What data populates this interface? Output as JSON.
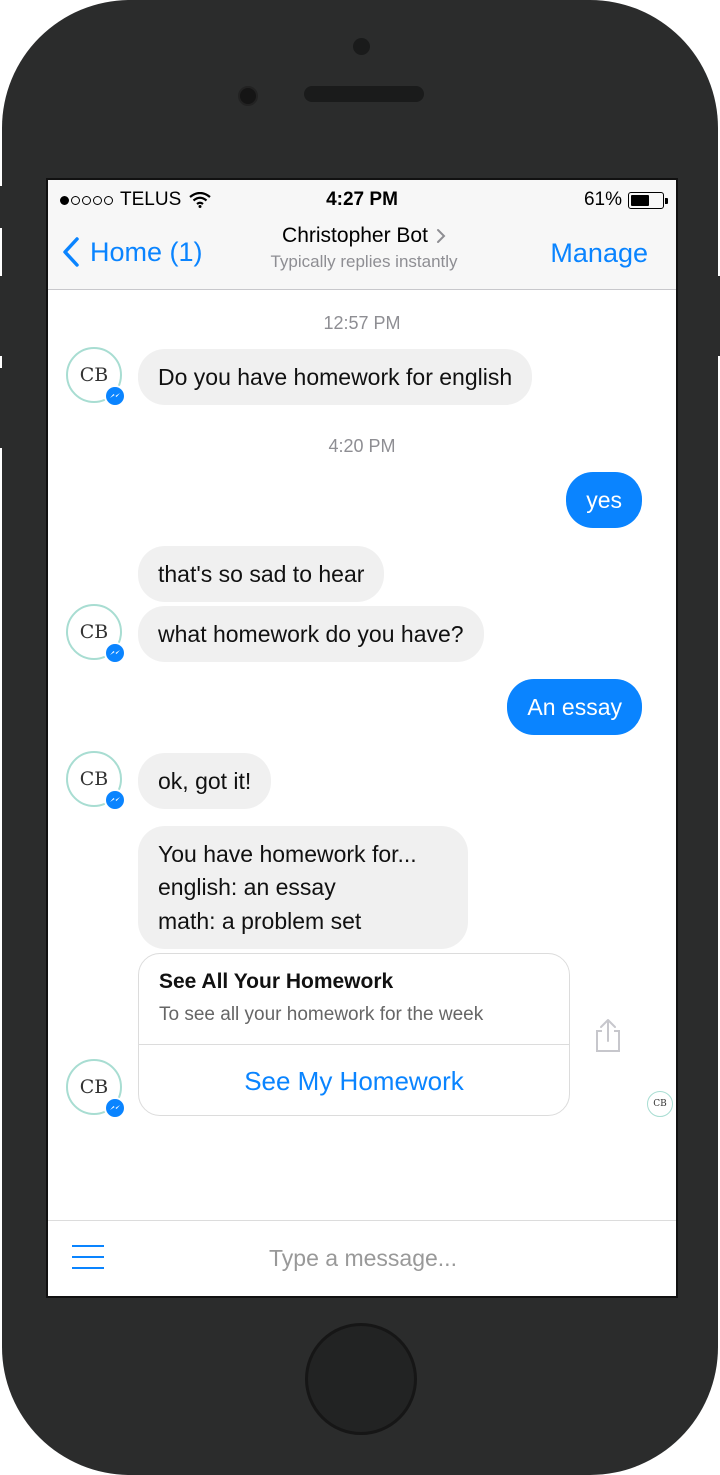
{
  "status_bar": {
    "carrier": "TELUS",
    "time": "4:27 PM",
    "battery_percent": "61%",
    "battery_level": 0.61,
    "signal_bars_filled": 1,
    "signal_bars_total": 5
  },
  "nav": {
    "back_label": "Home (1)",
    "title": "Christopher Bot",
    "subtitle": "Typically replies instantly",
    "manage_label": "Manage"
  },
  "conversation": {
    "timestamp_1": "12:57 PM",
    "msg_1": "Do you have homework for english",
    "timestamp_2": "4:20 PM",
    "msg_2": "yes",
    "msg_3": "that's so sad to hear",
    "msg_4": "what homework do you have?",
    "msg_5": "An essay",
    "msg_6": "ok, got it!",
    "msg_7_lines": [
      "You have homework for...",
      "english: an essay",
      "math: a problem set"
    ]
  },
  "avatar_initials": "CB",
  "card": {
    "title": "See All Your Homework",
    "subtitle": "To see all your homework for the week",
    "button_label": "See My Homework"
  },
  "composer": {
    "placeholder": "Type a message..."
  },
  "colors": {
    "accent": "#0a84ff",
    "incoming_bubble": "#f0f0f0",
    "phone_body": "#2b2c2c",
    "avatar_ring": "#a8ddd2"
  },
  "icons": [
    "wifi-icon",
    "battery-icon",
    "back-chevron-icon",
    "messenger-badge-icon",
    "share-icon",
    "menu-icon"
  ]
}
